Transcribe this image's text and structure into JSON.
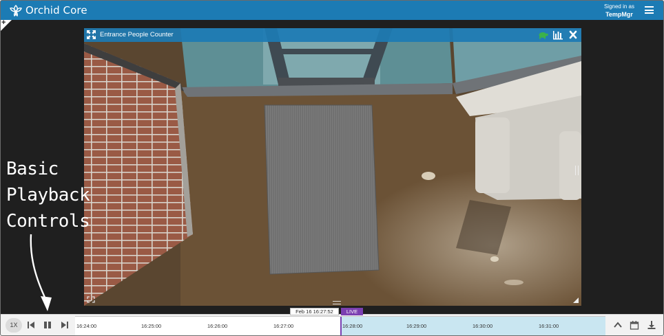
{
  "app": {
    "title": "Orchid Core",
    "signed_in_label": "Signed in as",
    "username": "TempMgr"
  },
  "add_tab": {
    "symbol": "+"
  },
  "tile": {
    "title": "Entrance People Counter"
  },
  "annotation": {
    "lines": [
      "Basic",
      "Playback",
      "Controls"
    ]
  },
  "timeline": {
    "speed": "1X",
    "current_datetime": "Feb 16 16:27:52",
    "live_label": "LIVE",
    "ticks": [
      "16:24:00",
      "16:25:00",
      "16:26:00",
      "16:27:00",
      "16:28:00",
      "16:29:00",
      "16:30:00",
      "16:31:00"
    ]
  },
  "colors": {
    "brand": "#1c7bb4",
    "live": "#7b3fb1",
    "live_range": "#c9e6f1",
    "turtle": "#3bb24a"
  }
}
